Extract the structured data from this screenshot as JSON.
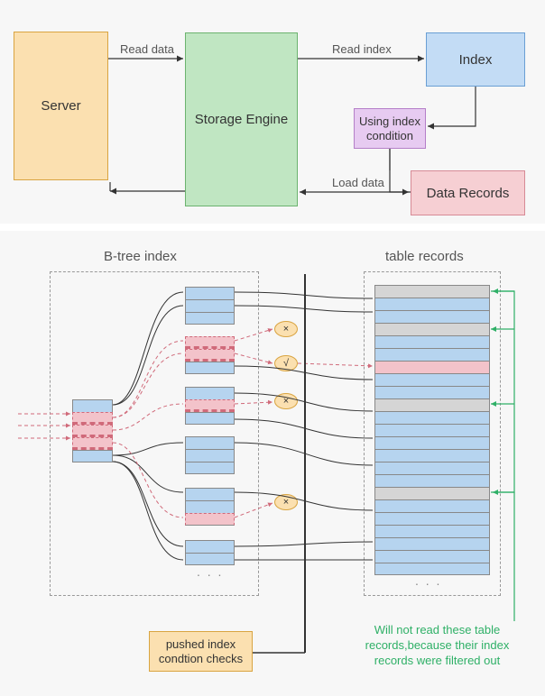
{
  "top": {
    "server": "Server",
    "storage": "Storage Engine",
    "index": "Index",
    "condition": "Using index condition",
    "data": "Data Records",
    "read_data": "Read data",
    "read_index": "Read index",
    "load_data": "Load data"
  },
  "bottom": {
    "btree_title": "B-tree index",
    "records_title": "table records",
    "pushed": "pushed index condtion checks",
    "filter_msg": "Will not read these table records,because their index records were filtered out",
    "dots": ". . .",
    "cross": "×",
    "check": "√"
  }
}
